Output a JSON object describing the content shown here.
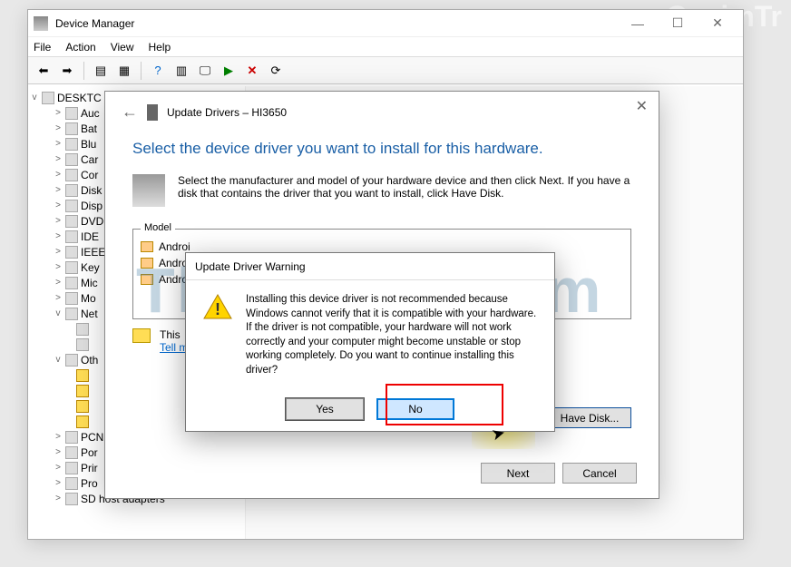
{
  "watermark": {
    "main": "ThongWP.Com",
    "corner": "QasimTr"
  },
  "devmgr": {
    "title": "Device Manager",
    "menu": [
      "File",
      "Action",
      "View",
      "Help"
    ],
    "tree_root": "DESKTC",
    "categories": [
      {
        "label": "Auc",
        "caret": ">"
      },
      {
        "label": "Bat",
        "caret": ">"
      },
      {
        "label": "Blu",
        "caret": ">"
      },
      {
        "label": "Car",
        "caret": ">"
      },
      {
        "label": "Cor",
        "caret": ">"
      },
      {
        "label": "Disk",
        "caret": ">"
      },
      {
        "label": "Disp",
        "caret": ">"
      },
      {
        "label": "DVD",
        "caret": ">"
      },
      {
        "label": "IDE",
        "caret": ">"
      },
      {
        "label": "IEEE",
        "caret": ">"
      },
      {
        "label": "Key",
        "caret": ">"
      },
      {
        "label": "Mic",
        "caret": ">"
      },
      {
        "label": "Mo",
        "caret": ">"
      },
      {
        "label": "Net",
        "caret": "v"
      },
      {
        "label": "",
        "caret": " ",
        "indent": 2
      },
      {
        "label": "",
        "caret": " ",
        "indent": 2
      },
      {
        "label": "Oth",
        "caret": "v"
      },
      {
        "label": "",
        "caret": " ",
        "indent": 2,
        "warn": true
      },
      {
        "label": "",
        "caret": " ",
        "indent": 2,
        "warn": true
      },
      {
        "label": "",
        "caret": " ",
        "indent": 2,
        "warn": true
      },
      {
        "label": "",
        "caret": " ",
        "indent": 2,
        "warn": true
      },
      {
        "label": "PCN",
        "caret": ">"
      },
      {
        "label": "Por",
        "caret": ">"
      },
      {
        "label": "Prir",
        "caret": ">"
      },
      {
        "label": "Pro",
        "caret": ">"
      },
      {
        "label": "SD host adapters",
        "caret": ">"
      }
    ]
  },
  "wizard": {
    "header_label": "Update Drivers – HI3650",
    "back_icon": "←",
    "heading": "Select the device driver you want to install for this hardware.",
    "instruction": "Select the manufacturer and model of your hardware device and then click Next. If you have a disk that contains the driver that you want to install, click Have Disk.",
    "model_legend": "Model",
    "models": [
      "Androi",
      "Androi",
      "Androi"
    ],
    "sig_text": "This",
    "sig_link": "Tell me why driver signing is important",
    "have_disk": "Have Disk...",
    "next": "Next",
    "cancel": "Cancel"
  },
  "warn": {
    "title": "Update Driver Warning",
    "text": "Installing this device driver is not recommended because Windows cannot verify that it is compatible with your hardware.  If the driver is not compatible, your hardware will not work correctly and your computer might become unstable or stop working completely.  Do you want to continue installing this driver?",
    "yes": "Yes",
    "no": "No"
  }
}
